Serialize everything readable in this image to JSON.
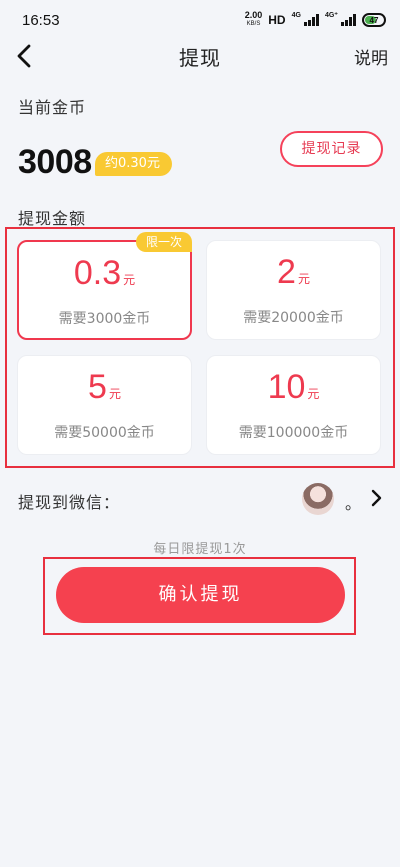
{
  "status": {
    "time": "16:53",
    "speed_value": "2.00",
    "speed_unit": "KB/S",
    "hd": "HD",
    "net1": "4G",
    "net2": "4G⁺",
    "battery": "47"
  },
  "nav": {
    "title": "提现",
    "help": "说明"
  },
  "balance": {
    "label": "当前金币",
    "amount": "3008",
    "approx": "约0.30元",
    "record_button": "提现记录"
  },
  "withdraw": {
    "label": "提现金额",
    "options": [
      {
        "value": "0.3",
        "unit": "元",
        "need": "需要3000金币",
        "tag": "限一次"
      },
      {
        "value": "2",
        "unit": "元",
        "need": "需要20000金币"
      },
      {
        "value": "5",
        "unit": "元",
        "need": "需要50000金币"
      },
      {
        "value": "10",
        "unit": "元",
        "need": "需要100000金币"
      }
    ]
  },
  "wechat": {
    "label": "提现到微信：",
    "nickname": "。"
  },
  "limit_note": "每日限提现1次",
  "confirm_button": "确认提现",
  "colors": {
    "accent": "#f5414f",
    "badge": "#f9c933",
    "background": "#f3f5f9"
  },
  "icons": [
    "back-icon",
    "chevron-right-icon",
    "avatar"
  ]
}
